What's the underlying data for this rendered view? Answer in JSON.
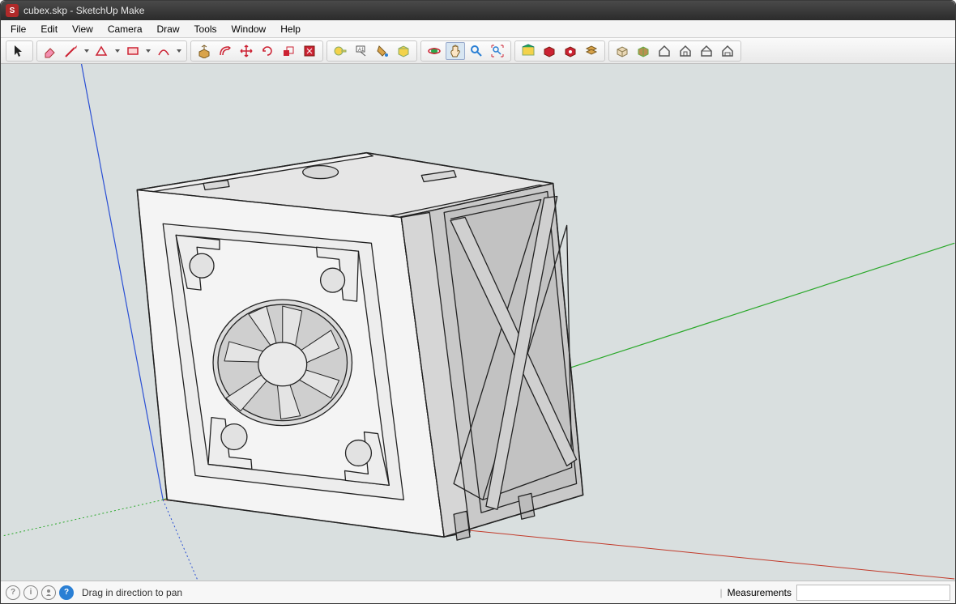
{
  "titlebar": {
    "app_icon_letter": "S",
    "title": "cubex.skp - SketchUp Make"
  },
  "menus": [
    "File",
    "Edit",
    "View",
    "Camera",
    "Draw",
    "Tools",
    "Window",
    "Help"
  ],
  "toolbar": {
    "group1": [
      "select"
    ],
    "group2": [
      "eraser",
      "pencil",
      "dd",
      "shapes",
      "dd",
      "rectangle",
      "dd",
      "arc",
      "dd"
    ],
    "group3": [
      "pushpull",
      "offset",
      "move",
      "rotate",
      "scale",
      "followme"
    ],
    "group4": [
      "tape",
      "text",
      "dimension",
      "paint"
    ],
    "group5": [
      "orbit",
      "pan",
      "zoom",
      "zoom-extents"
    ],
    "group6": [
      "warehouse",
      "3dwh",
      "extension",
      "layers"
    ],
    "group7": [
      "box",
      "package",
      "house1",
      "house2",
      "house3",
      "house4"
    ]
  },
  "status": {
    "icons": [
      "instructor",
      "geo",
      "person",
      "help"
    ],
    "hint": "Drag in direction to pan",
    "measurements_label": "Measurements",
    "measurements_value": ""
  },
  "colors": {
    "axis_blue": "#2a4fd4",
    "axis_green": "#2aa82a",
    "axis_red": "#c23a2a",
    "viewport_bg": "#d9dfdf",
    "model_light": "#f2f2f2",
    "model_mid": "#d0d0d0",
    "model_dark": "#bcbcbc",
    "edge": "#222"
  }
}
